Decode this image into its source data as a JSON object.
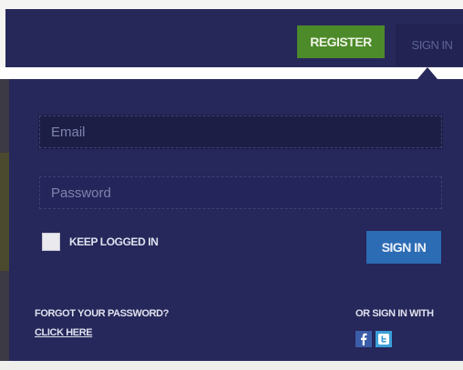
{
  "header": {
    "register_label": "REGISTER",
    "signin_tab_label": "SIGN IN"
  },
  "login": {
    "email_placeholder": "Email",
    "password_placeholder": "Password",
    "keep_logged_in_label": "KEEP LOGGED IN",
    "keep_logged_in_checked": false,
    "submit_label": "SIGN IN"
  },
  "footer": {
    "forgot_text": "FORGOT YOUR PASSWORD?",
    "click_here_label": "CLICK HERE",
    "or_sign_in_with": "OR SIGN IN WITH",
    "social": [
      {
        "icon": "facebook-icon",
        "color": "#3b5da8"
      },
      {
        "icon": "twitter-icon",
        "color": "#3b9fd8"
      }
    ]
  },
  "colors": {
    "navy": "#26275a",
    "register_green": "#4c8a2a",
    "signin_blue": "#2c6cb4"
  }
}
